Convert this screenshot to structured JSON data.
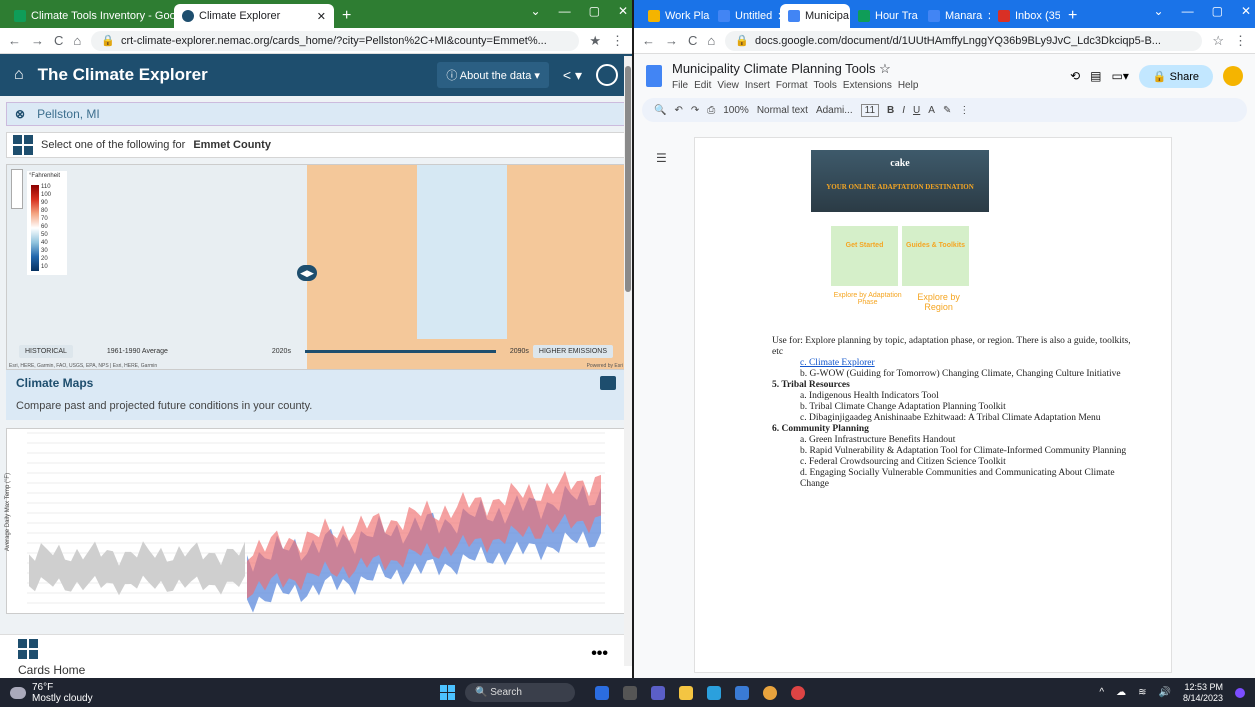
{
  "left_window": {
    "tabs": [
      {
        "label": "Climate Tools Inventory - Google"
      },
      {
        "label": "Climate Explorer"
      }
    ],
    "url": "crt-climate-explorer.nemac.org/cards_home/?city=Pellston%2C+MI&county=Emmet%...",
    "app_title": "The Climate Explorer",
    "about_label": "About the data",
    "location": "Pellston, MI",
    "select_prefix": "Select one of the following for",
    "county": "Emmet County",
    "map": {
      "legend_title": "°Fahrenheit",
      "legend_ticks": [
        "110",
        "100",
        "90",
        "80",
        "70",
        "60",
        "50",
        "40",
        "30",
        "20",
        "10"
      ],
      "left_period": "HISTORICAL",
      "left_range": "1961-1990 Average",
      "right_start": "2020s",
      "right_end": "2090s",
      "right_chip": "2090s",
      "scenario": "HIGHER EMISSIONS",
      "attribution": "Esri, HERE, Garmin, FAO, USGS, EPA, NPS | Esri, HERE, Garmin",
      "powered": "Powered by Esri"
    },
    "card_title": "Climate Maps",
    "card_desc": "Compare past and projected future conditions in your county.",
    "chart_ylabel": "Average Daily Max Temp (°F)",
    "cards_home": "Cards Home"
  },
  "right_window": {
    "tabs": [
      {
        "label": "Work Pla"
      },
      {
        "label": "Untitled"
      },
      {
        "label": "Municipa"
      },
      {
        "label": "Hour Tra"
      },
      {
        "label": "Manara"
      },
      {
        "label": "Inbox (35"
      }
    ],
    "url": "docs.google.com/document/d/1UUtHAmffyLnggYQ36b9BLy9JvC_Ldc3Dkciqp5-B...",
    "doc_title": "Municipality Climate Planning Tools",
    "menu": [
      "File",
      "Edit",
      "View",
      "Insert",
      "Format",
      "Tools",
      "Extensions",
      "Help"
    ],
    "share": "Share",
    "zoom": "100%",
    "style": "Normal text",
    "font": "Adami...",
    "font_size": "11",
    "cake": {
      "banner": "YOUR ONLINE ADAPTATION DESTINATION",
      "logo": "cake",
      "card1": "Get Started",
      "card2": "Guides & Toolkits",
      "ex1": "Explore by Adaptation Phase",
      "ex2": "Explore by Region"
    },
    "usefor": "Use for: Explore planning by topic, adaptation phase, or region.  There is also a guide, toolkits, etc",
    "items_c": "c.  Climate Explorer",
    "items_d": "b.  G-WOW (Guiding for Tomorrow) Changing Climate, Changing Culture Initiative",
    "sec5": "5.   Tribal Resources",
    "sec5_items": [
      "a.  Indigenous Health Indicators Tool",
      "b.  Tribal Climate Change Adaptation Planning Toolkit",
      "c.  Dibaginjigaadeg Anishinaabe Ezhitwaad: A Tribal Climate Adaptation Menu"
    ],
    "sec6": "6.   Community Planning",
    "sec6_items": [
      "a.  Green Infrastructure Benefits Handout",
      "b.  Rapid Vulnerability & Adaptation Tool for Climate-Informed Community Planning",
      "c.  Federal Crowdsourcing and Citizen Science Toolkit",
      "d.  Engaging Socially Vulnerable Communities and Communicating About Climate Change"
    ]
  },
  "taskbar": {
    "temp": "76°F",
    "weather": "Mostly cloudy",
    "search": "Search",
    "time": "12:53 PM",
    "date": "8/14/2023"
  }
}
